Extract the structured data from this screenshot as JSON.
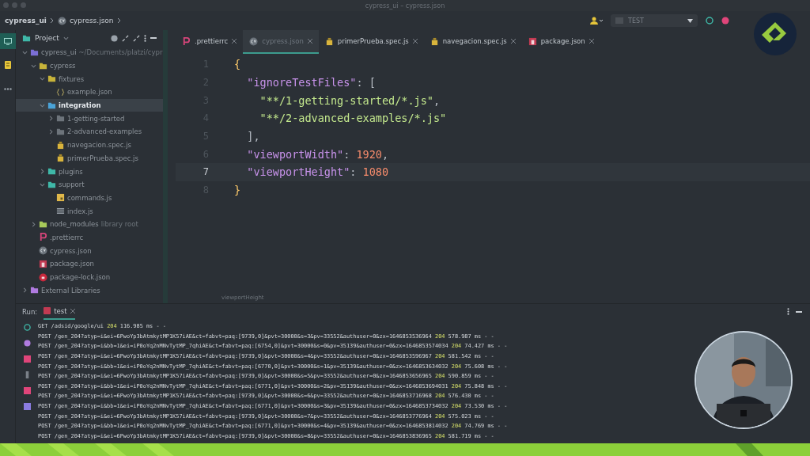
{
  "window": {
    "title": "cypress_ui – cypress.json"
  },
  "breadcrumb": [
    {
      "label": "cypress_ui",
      "kind": "folder"
    },
    {
      "label": "cypress.json",
      "kind": "cypress"
    }
  ],
  "toolbar": {
    "run_config": "TEST"
  },
  "tool_strip": [
    {
      "kind": "project",
      "selected": true
    },
    {
      "kind": "structure",
      "selected": false
    },
    {
      "kind": "more",
      "selected": false
    }
  ],
  "project_panel": {
    "title": "Project",
    "tree": [
      {
        "label": "cypress_ui",
        "note": "~/Documents/platzi/cypr",
        "kind": "module",
        "expanded": true,
        "selected": false,
        "children": [
          {
            "label": "cypress",
            "kind": "folder",
            "expanded": true,
            "selected": false,
            "children": [
              {
                "label": "fixtures",
                "kind": "folder",
                "expanded": true,
                "selected": false,
                "children": [
                  {
                    "label": "example.json",
                    "kind": "json",
                    "selected": false
                  }
                ]
              },
              {
                "label": "integration",
                "kind": "testfolder",
                "expanded": true,
                "selected": true,
                "children": [
                  {
                    "label": "1-getting-started",
                    "kind": "plainfolder",
                    "expanded": false,
                    "selected": false
                  },
                  {
                    "label": "2-advanced-examples",
                    "kind": "plainfolder",
                    "expanded": false,
                    "selected": false
                  },
                  {
                    "label": "navegacion.spec.js",
                    "kind": "spec",
                    "selected": false
                  },
                  {
                    "label": "primerPrueba.spec.js",
                    "kind": "spec",
                    "selected": false
                  }
                ]
              },
              {
                "label": "plugins",
                "kind": "tealfolder",
                "expanded": false,
                "selected": false
              },
              {
                "label": "support",
                "kind": "tealfolder",
                "expanded": true,
                "selected": false,
                "children": [
                  {
                    "label": "commands.js",
                    "kind": "js",
                    "selected": false
                  },
                  {
                    "label": "index.js",
                    "kind": "index",
                    "selected": false
                  }
                ]
              }
            ]
          },
          {
            "label": "node_modules",
            "note": "library root",
            "kind": "library",
            "expanded": false,
            "selected": false
          },
          {
            "label": ".prettierrc",
            "kind": "prettier",
            "selected": false
          },
          {
            "label": "cypress.json",
            "kind": "cypress",
            "selected": false
          },
          {
            "label": "package.json",
            "kind": "npm",
            "selected": false
          },
          {
            "label": "package-lock.json",
            "kind": "lock",
            "selected": false
          }
        ]
      },
      {
        "label": "External Libraries",
        "kind": "extlib",
        "expanded": false,
        "selected": false
      }
    ]
  },
  "tabs": [
    {
      "label": ".prettierrc",
      "kind": "prettier",
      "selected": false
    },
    {
      "label": "cypress.json",
      "kind": "cypress",
      "selected": true
    },
    {
      "label": "primerPrueba.spec.js",
      "kind": "spec",
      "selected": false
    },
    {
      "label": "navegacion.spec.js",
      "kind": "spec",
      "selected": false
    },
    {
      "label": "package.json",
      "kind": "npm",
      "selected": false
    }
  ],
  "code": [
    {
      "number": "1",
      "current": false,
      "tokens": [
        {
          "kind": "brace",
          "text": "{"
        }
      ]
    },
    {
      "number": "2",
      "current": false,
      "tokens": [
        {
          "kind": "key",
          "text": "  \"ignoreTestFiles\""
        },
        {
          "kind": "punct",
          "text": ": ["
        }
      ]
    },
    {
      "number": "3",
      "current": false,
      "tokens": [
        {
          "kind": "string",
          "text": "    \"**/1-getting-started/*.js\""
        },
        {
          "kind": "punct",
          "text": ","
        }
      ]
    },
    {
      "number": "4",
      "current": false,
      "tokens": [
        {
          "kind": "string",
          "text": "    \"**/2-advanced-examples/*.js\""
        }
      ]
    },
    {
      "number": "5",
      "current": false,
      "tokens": [
        {
          "kind": "punct",
          "text": "  ],"
        }
      ]
    },
    {
      "number": "6",
      "current": false,
      "tokens": [
        {
          "kind": "key",
          "text": "  \"viewportWidth\""
        },
        {
          "kind": "punct",
          "text": ": "
        },
        {
          "kind": "number",
          "text": "1920"
        },
        {
          "kind": "punct",
          "text": ","
        }
      ]
    },
    {
      "number": "7",
      "current": true,
      "tokens": [
        {
          "kind": "key",
          "text": "  \"viewportHeight\""
        },
        {
          "kind": "punct",
          "text": ": "
        },
        {
          "kind": "number",
          "text": "1080"
        }
      ]
    },
    {
      "number": "8",
      "current": false,
      "tokens": [
        {
          "kind": "brace",
          "text": "}"
        }
      ]
    }
  ],
  "editor_breadcrumb": "viewportHeight",
  "run_panel": {
    "label": "Run:",
    "tab": "test",
    "log": [
      {
        "request": "GET /adsid/google/ui",
        "status": "204",
        "rest": "116.985 ms - -"
      },
      {
        "request": "POST /gen_204?atyp=i&ei=6PwoYp3bAtmkytMP1K57iAE&ct=fabvt=paq:[9739,0]&pvt=30000&s=3&pv=33552&authuser=0&zx=1646853536964",
        "status": "204",
        "rest": "578.987 ms - -"
      },
      {
        "request": "POST /gen_204?atyp=i&bb=1&ei=iP0oYq2nMNvTytMP_7qhiAE&ct=fabvt=paq:[6754,0]&pvt=30000&s=0&pv=35139&authuser=0&zx=1646853574034",
        "status": "204",
        "rest": "74.427 ms - -"
      },
      {
        "request": "POST /gen_204?atyp=i&ei=6PwoYp3bAtmkytMP1K57iAE&ct=fabvt=paq:[9739,0]&pvt=30000&s=4&pv=33552&authuser=0&zx=1646853596967",
        "status": "204",
        "rest": "581.542 ms - -"
      },
      {
        "request": "POST /gen_204?atyp=i&bb=1&ei=iP0oYq2nMNvTytMP_7qhiAE&ct=fabvt=paq:[6770,0]&pvt=30000&s=1&pv=35139&authuser=0&zx=1646853634032",
        "status": "204",
        "rest": "75.608 ms - -"
      },
      {
        "request": "POST /gen_204?atyp=i&ei=6PwoYp3bAtmkytMP1K57iAE&ct=fabvt=paq:[9739,0]&pvt=30000&s=5&pv=33552&authuser=0&zx=1646853656965",
        "status": "204",
        "rest": "590.859 ms - -"
      },
      {
        "request": "POST /gen_204?atyp=i&bb=1&ei=iP0oYq2nMNvTytMP_7qhiAE&ct=fabvt=paq:[6771,0]&pvt=30000&s=2&pv=35139&authuser=0&zx=1646853694031",
        "status": "204",
        "rest": "75.848 ms - -"
      },
      {
        "request": "POST /gen_204?atyp=i&ei=6PwoYp3bAtmkytMP1K57iAE&ct=fabvt=paq:[9739,0]&pvt=30000&s=6&pv=33552&authuser=0&zx=1646853716968",
        "status": "204",
        "rest": "576.430 ms - -"
      },
      {
        "request": "POST /gen_204?atyp=i&bb=1&ei=iP0oYq2nMNvTytMP_7qhiAE&ct=fabvt=paq:[6771,0]&pvt=30000&s=3&pv=35139&authuser=0&zx=1646853734032",
        "status": "204",
        "rest": "73.530 ms - -"
      },
      {
        "request": "POST /gen_204?atyp=i&ei=6PwoYp3bAtmkytMP1K57iAE&ct=fabvt=paq:[9739,0]&pvt=30000&s=7&pv=33552&authuser=0&zx=1646853776964",
        "status": "204",
        "rest": "575.023 ms - -"
      },
      {
        "request": "POST /gen_204?atyp=i&bb=1&ei=iP0oYq2nMNvTytMP_7qhiAE&ct=fabvt=paq:[6771,0]&pvt=30000&s=4&pv=35139&authuser=0&zx=1646853814032",
        "status": "204",
        "rest": "74.769 ms - -"
      },
      {
        "request": "POST /gen_204?atyp=i&ei=6PwoYp3bAtmkytMP1K57iAE&ct=fabvt=paq:[9739,0]&pvt=30000&s=8&pv=33552&authuser=0&zx=1646853836965",
        "status": "204",
        "rest": "581.719 ms - -"
      }
    ]
  }
}
